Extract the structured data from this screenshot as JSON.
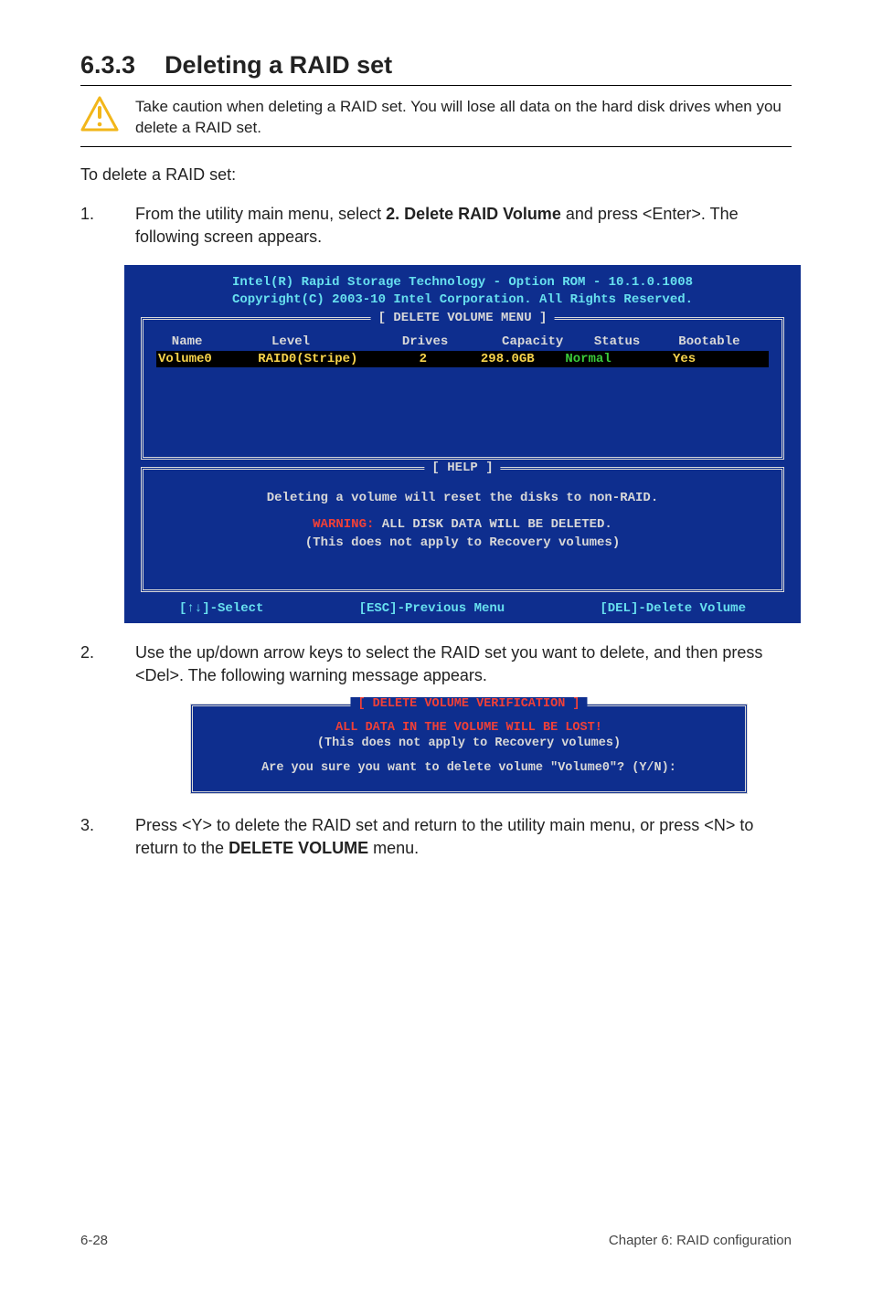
{
  "section": {
    "number": "6.3.3",
    "title": "Deleting a RAID set"
  },
  "caution": {
    "text": "Take caution when deleting a RAID set. You will lose all data on the hard disk drives when you delete a RAID set."
  },
  "intro": "To delete a RAID set:",
  "steps": [
    {
      "num": "1.",
      "text_before": "From the utility main menu, select ",
      "bold": "2. Delete RAID Volume",
      "text_after": " and press <Enter>. The following screen appears."
    },
    {
      "num": "2.",
      "full": "Use the up/down arrow keys to select the RAID set you want to delete, and then press <Del>. The following warning message appears."
    },
    {
      "num": "3.",
      "text_before": "Press <Y> to delete the RAID set and return to the utility main menu, or press <N> to return to the ",
      "bold": "DELETE VOLUME",
      "text_after": " menu."
    }
  ],
  "bios1": {
    "header1": "Intel(R) Rapid Storage Technology - Option ROM - 10.1.0.1008",
    "header2": "Copyright(C) 2003-10 Intel Corporation.  All Rights Reserved.",
    "delMenuCaption": "[ DELETE VOLUME MENU ]",
    "colHeader": "  Name         Level            Drives       Capacity    Status     Bootable",
    "row_name": "Volume0",
    "row_level": "RAID0(Stripe)",
    "row_drives": "2",
    "row_capacity": "298.0GB",
    "row_status": "Normal",
    "row_bootable": "Yes",
    "helpCaption": "[ HELP ]",
    "help1": "Deleting a volume will reset the disks to non-RAID.",
    "help_warn_label": "WARNING:",
    "help_warn_rest": " ALL DISK DATA WILL BE DELETED.",
    "help3": "(This does not apply to Recovery volumes)",
    "foot_left": "[↑↓]-Select",
    "foot_mid": "[ESC]-Previous Menu",
    "foot_right": "[DEL]-Delete Volume"
  },
  "dialog": {
    "caption": "[ DELETE VOLUME VERIFICATION ]",
    "lost": "ALL DATA IN THE VOLUME WILL BE LOST!",
    "recov": "(This does not apply to Recovery volumes)",
    "confirm": "Are you sure you want to delete volume \"Volume0\"? (Y/N):"
  },
  "footer": {
    "left": "6-28",
    "right": "Chapter 6: RAID configuration"
  },
  "chart_data": {
    "type": "table",
    "title": "DELETE VOLUME MENU",
    "columns": [
      "Name",
      "Level",
      "Drives",
      "Capacity",
      "Status",
      "Bootable"
    ],
    "rows": [
      {
        "Name": "Volume0",
        "Level": "RAID0(Stripe)",
        "Drives": 2,
        "Capacity": "298.0GB",
        "Status": "Normal",
        "Bootable": "Yes"
      }
    ]
  }
}
